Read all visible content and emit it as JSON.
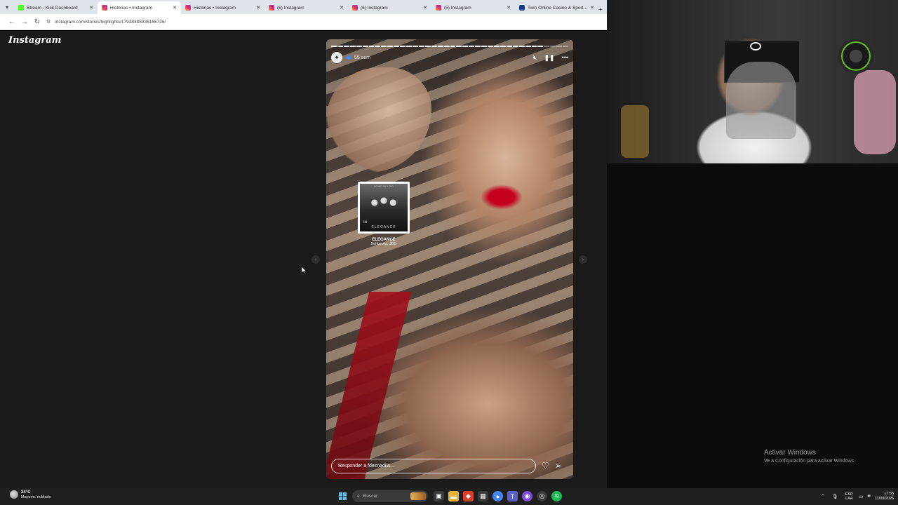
{
  "browser": {
    "tabs": [
      {
        "title": "Stream - Kick Dashboard",
        "favicon": "kick",
        "active": false
      },
      {
        "title": "Historias • Instagram",
        "favicon": "instagram",
        "active": true
      },
      {
        "title": "Historias • Instagram",
        "favicon": "instagram",
        "active": false
      },
      {
        "title": "(6) Instagram",
        "favicon": "instagram",
        "active": false
      },
      {
        "title": "(6) Instagram",
        "favicon": "instagram",
        "active": false
      },
      {
        "title": "(5) Instagram",
        "favicon": "instagram",
        "active": false
      },
      {
        "title": "Twin Online Casino & Sports Betting",
        "favicon": "twin",
        "active": false
      }
    ],
    "url": "instagram.com/stories/highlights/17938385936166726/"
  },
  "instagram": {
    "logo": "Instagram",
    "story": {
      "progress_segments_total": 38,
      "progress_segments_done": 34,
      "age": "55 sem",
      "music": {
        "album_word": "ELEGANCE",
        "album_top": "SEHBE AS & JBG",
        "title": "ELEGANCE",
        "artist": "Sehbe As, JBG"
      },
      "reply_placeholder": "Responder a fdeznadiia..."
    }
  },
  "watermark": {
    "title": "Activar Windows",
    "subtitle": "Ve a Configuración para activar Windows."
  },
  "taskbar": {
    "weather_temp": "24°C",
    "weather_condition": "Mayorm. nublado",
    "search_placeholder": "Buscar",
    "lang_top": "ESP",
    "lang_bottom": "LAA",
    "time": "17:55",
    "date": "11/03/2026"
  }
}
